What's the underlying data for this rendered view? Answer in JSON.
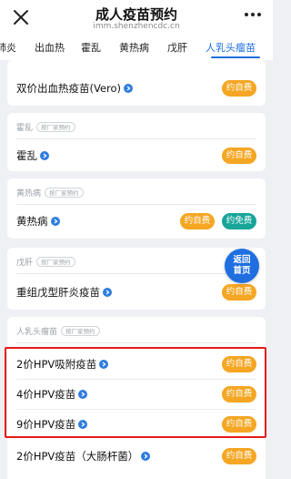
{
  "header": {
    "title": "成人疫苗预约",
    "url": "imm.shenzhencdc.cn"
  },
  "tabs": [
    {
      "label": "肺炎"
    },
    {
      "label": "出血热"
    },
    {
      "label": "霍乱"
    },
    {
      "label": "黄热病"
    },
    {
      "label": "戊肝"
    },
    {
      "label": "人乳头瘤苗",
      "active": true
    }
  ],
  "sections": {
    "hemorrhagic": {
      "vaccines": [
        {
          "name": "双价出血热疫苗(Vero)",
          "button": "约自费"
        }
      ]
    },
    "cholera": {
      "name": "霍乱",
      "tag": "按厂家预约",
      "vaccines": [
        {
          "name": "霍乱",
          "button": "约自费"
        }
      ]
    },
    "yellow_fever": {
      "name": "黄热病",
      "tag": "按厂家预约",
      "vaccines": [
        {
          "name": "黄热病",
          "button": "约自费",
          "button2": "约免费"
        }
      ]
    },
    "hepatitis_e": {
      "name": "戊肝",
      "tag": "按厂家预约",
      "vaccines": [
        {
          "name": "重组戊型肝炎疫苗",
          "button": "约自费"
        }
      ]
    },
    "hpv": {
      "name": "人乳头瘤苗",
      "tag": "按厂家预约",
      "vaccines": [
        {
          "name": "2价HPV吸附疫苗",
          "button": "约自费"
        },
        {
          "name": "4价HPV疫苗",
          "button": "约自费"
        },
        {
          "name": "9价HPV疫苗",
          "button": "约自费"
        },
        {
          "name": "2价HPV疫苗（大肠杆菌）",
          "button": "约自费"
        }
      ]
    }
  },
  "home_button": {
    "line1": "返回",
    "line2": "首页"
  },
  "colors": {
    "accent": "#1f6fe0",
    "self_pay": "#f5a623",
    "free": "#17a59a",
    "highlight": "#e3191c"
  }
}
